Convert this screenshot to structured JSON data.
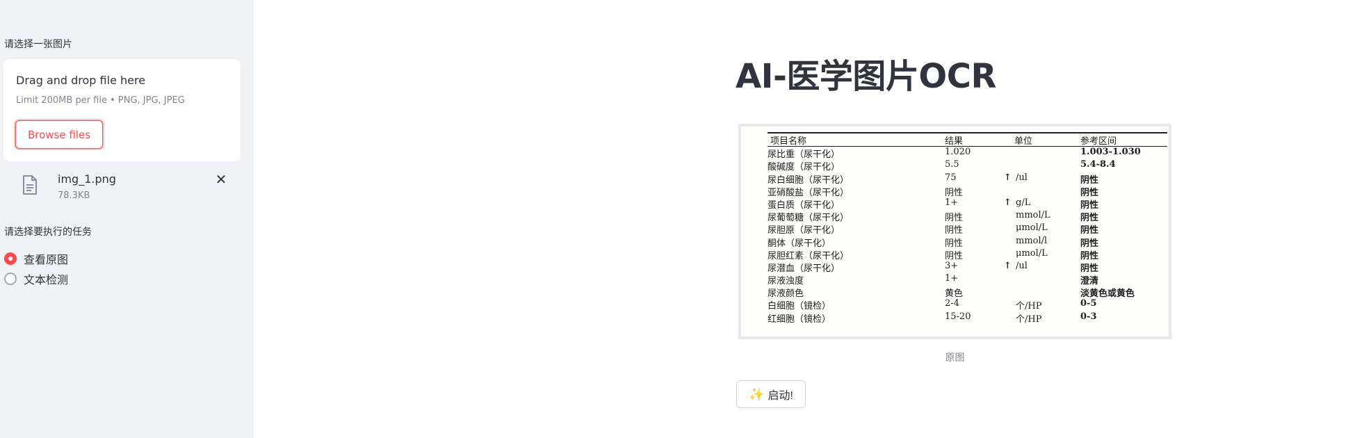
{
  "sidebar": {
    "upload_label": "请选择一张图片",
    "dropzone": {
      "title": "Drag and drop file here",
      "limit": "Limit 200MB per file • PNG, JPG, JPEG",
      "browse_label": "Browse files"
    },
    "file": {
      "name": "img_1.png",
      "size": "78.3KB",
      "icon": "file-icon",
      "close_icon": "close-icon"
    },
    "task_label": "请选择要执行的任务",
    "tasks": [
      {
        "label": "查看原图",
        "checked": true
      },
      {
        "label": "文本检测",
        "checked": false
      }
    ]
  },
  "main": {
    "title": "AI-医学图片OCR",
    "image_caption": "原图",
    "start_button": "启动!",
    "start_icon": "sparkle-icon",
    "report": {
      "headers": {
        "name": "项目名称",
        "result": "结果",
        "unit": "单位",
        "ref": "参考区间"
      },
      "rows": [
        {
          "name": "尿比重（尿干化）",
          "result": "1.020",
          "arrow": "",
          "unit": "",
          "ref": "1.003-1.030"
        },
        {
          "name": "酸碱度（尿干化）",
          "result": "5.5",
          "arrow": "",
          "unit": "",
          "ref": "5.4-8.4"
        },
        {
          "name": "尿白细胞（尿干化）",
          "result": "75",
          "arrow": "↑",
          "unit": "/ul",
          "ref": "阴性"
        },
        {
          "name": "亚硝酸盐（尿干化）",
          "result": "阴性",
          "arrow": "",
          "unit": "",
          "ref": "阴性"
        },
        {
          "name": "蛋白质（尿干化）",
          "result": "1+",
          "arrow": "↑",
          "unit": "g/L",
          "ref": "阴性"
        },
        {
          "name": "尿葡萄糖（尿干化）",
          "result": "阴性",
          "arrow": "",
          "unit": "mmol/L",
          "ref": "阴性"
        },
        {
          "name": "尿胆原（尿干化）",
          "result": "阴性",
          "arrow": "",
          "unit": "μmol/L",
          "ref": "阴性"
        },
        {
          "name": "酮体（尿干化）",
          "result": "阴性",
          "arrow": "",
          "unit": "mmol/l",
          "ref": "阴性"
        },
        {
          "name": "尿胆红素（尿干化）",
          "result": "阴性",
          "arrow": "",
          "unit": "μmol/L",
          "ref": "阴性"
        },
        {
          "name": "尿潜血（尿干化）",
          "result": "3+",
          "arrow": "↑",
          "unit": "/ul",
          "ref": "阴性"
        },
        {
          "name": "尿液浊度",
          "result": "1+",
          "arrow": "",
          "unit": "",
          "ref": "澄清"
        },
        {
          "name": "尿液颜色",
          "result": "黄色",
          "arrow": "",
          "unit": "",
          "ref": "淡黄色或黄色"
        },
        {
          "name": "白细胞（镜检）",
          "result": "2-4",
          "arrow": "",
          "unit": "个/HP",
          "ref": "0-5"
        },
        {
          "name": "红细胞（镜检）",
          "result": "15-20",
          "arrow": "",
          "unit": "个/HP",
          "ref": "0-3"
        }
      ]
    }
  },
  "colors": {
    "accent": "#ff4b4b",
    "sidebar_bg": "#f0f2f6",
    "text": "#31333f",
    "muted": "#808495"
  }
}
